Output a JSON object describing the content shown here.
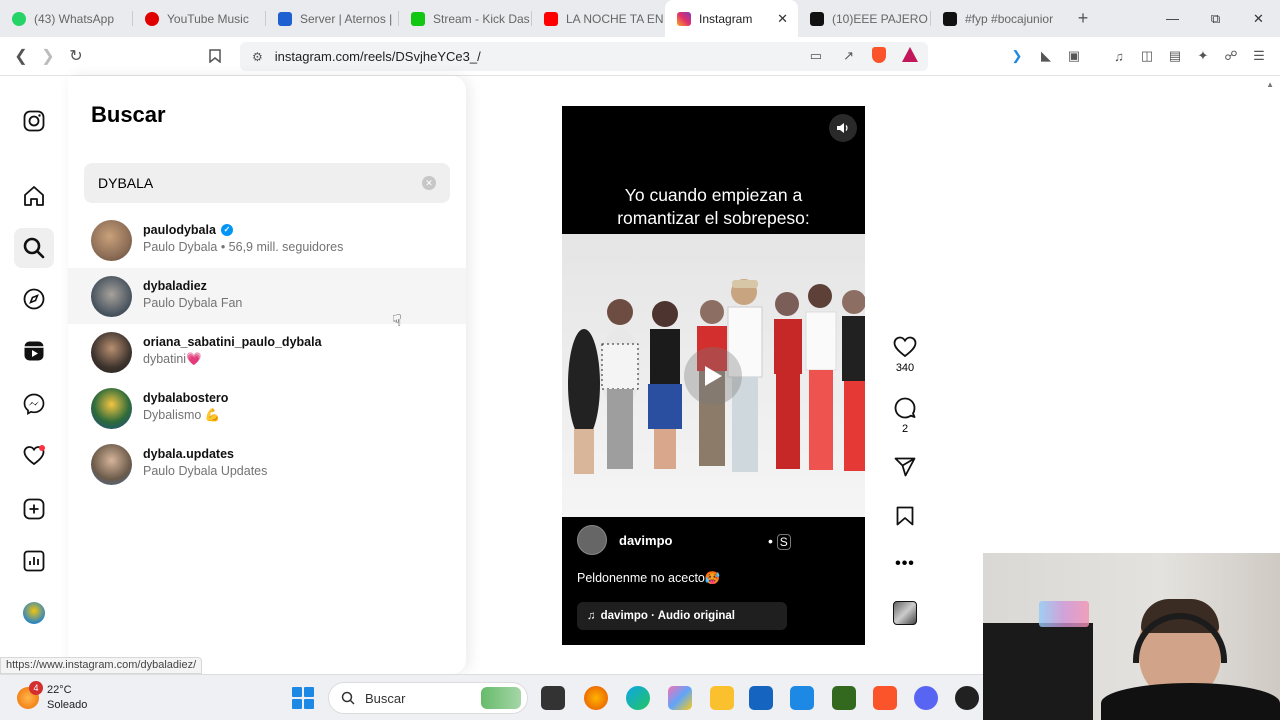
{
  "browser": {
    "tabs": [
      {
        "label": "(43) WhatsApp",
        "color": "#25d366",
        "active": false
      },
      {
        "label": "YouTube Music",
        "color": "#e00000",
        "active": false
      },
      {
        "label": "Server | Aternos |",
        "color": "#1e5fd1",
        "active": false
      },
      {
        "label": "Stream - Kick Das",
        "color": "#11c711",
        "active": false
      },
      {
        "label": "LA NOCHE TA EN",
        "color": "#ff0000",
        "active": false
      },
      {
        "label": "Instagram",
        "color": "#e1306c",
        "active": true
      },
      {
        "label": "(10)EEE PAJERO #",
        "color": "#111111",
        "active": false
      },
      {
        "label": "#fyp #bocajunior",
        "color": "#111111",
        "active": false
      }
    ],
    "url": "instagram.com/reels/DSvjheYCe3_/",
    "status_url": "https://www.instagram.com/dybaladiez/"
  },
  "search_panel": {
    "title": "Buscar",
    "query": "DYBALA",
    "results": [
      {
        "username": "paulodybala",
        "verified": true,
        "subtitle": "Paulo Dybala • 56,9 mill. seguidores",
        "avatar_color": "#8d6e57"
      },
      {
        "username": "dybaladiez",
        "verified": false,
        "subtitle": "Paulo Dybala Fan",
        "avatar_color": "#4a5560"
      },
      {
        "username": "oriana_sabatini_paulo_dybala",
        "verified": false,
        "subtitle": "dybatini💗",
        "avatar_color": "#3e342e"
      },
      {
        "username": "dybalabostero",
        "verified": false,
        "subtitle": "Dybalismo 💪",
        "avatar_color": "#2f6b3a"
      },
      {
        "username": "dybala.updates",
        "verified": false,
        "subtitle": "Paulo Dybala Updates",
        "avatar_color": "#6b5a4a"
      }
    ]
  },
  "reel": {
    "caption_line1": "Yo cuando empiezan a",
    "caption_line2": "romantizar el sobrepeso:",
    "author": "davimpo",
    "description": "Peldonenme no acecto🥵",
    "audio": "davimpo · Audio original",
    "likes": "340",
    "comments": "2"
  },
  "taskbar": {
    "temperature": "22°C",
    "weather": "Soleado",
    "weather_badge": "4",
    "search_placeholder": "Buscar"
  }
}
